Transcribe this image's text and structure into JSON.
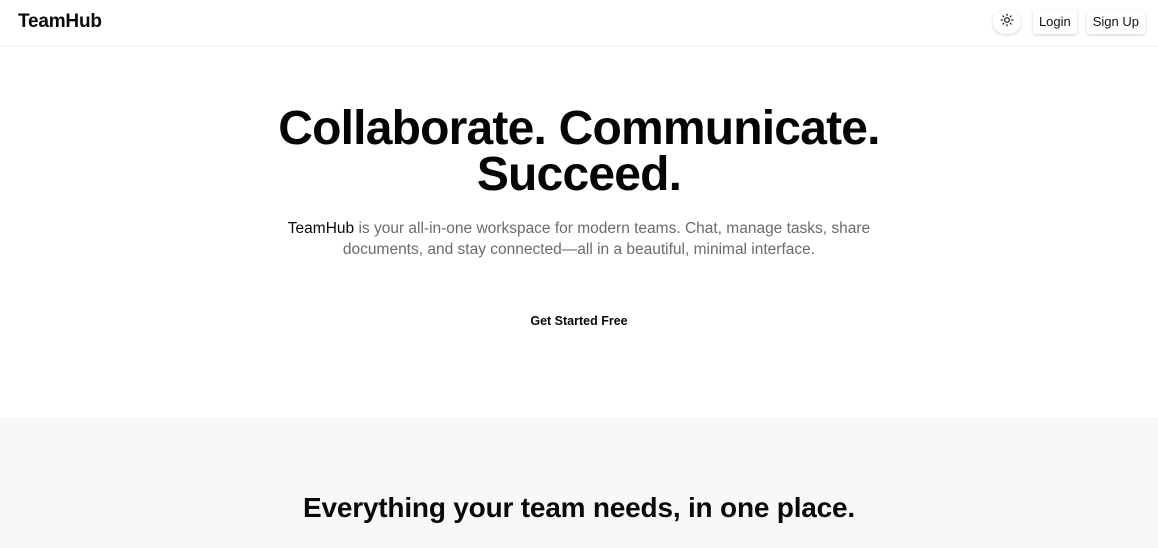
{
  "header": {
    "brand": "TeamHub",
    "theme_toggle_icon": "sun-icon",
    "login_label": "Login",
    "signup_label": "Sign Up"
  },
  "hero": {
    "title_line1": "Collaborate. Communicate.",
    "title_line2": "Succeed.",
    "subtitle_brand": "TeamHub",
    "subtitle_rest": " is your all-in-one workspace for modern teams. Chat, manage tasks, share documents, and stay connected—all in a beautiful, minimal interface.",
    "cta_label": "Get Started Free"
  },
  "features": {
    "title": "Everything your team needs, in one place."
  },
  "colors": {
    "text": "#0a0a0a",
    "muted": "#6b6b6b",
    "section_bg": "#f8f8f8"
  }
}
